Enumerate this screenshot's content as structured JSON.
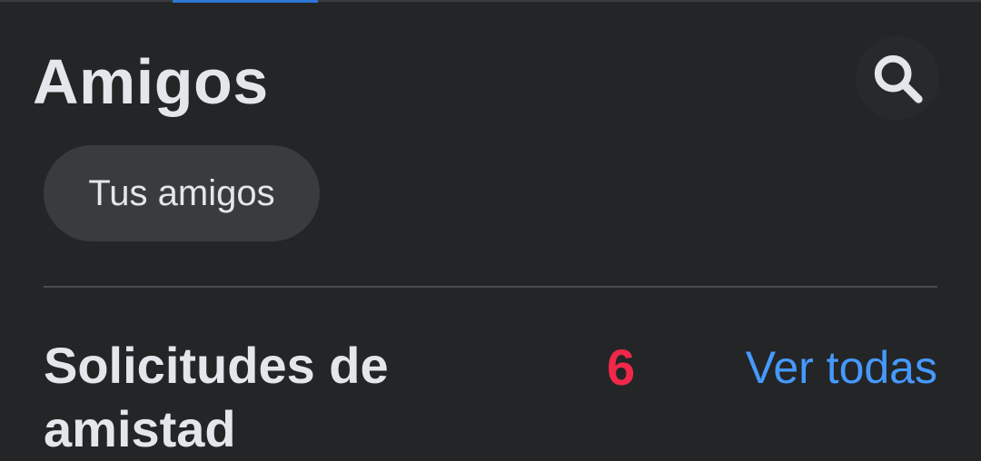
{
  "header": {
    "title": "Amigos",
    "search_icon": "search-icon"
  },
  "filters": {
    "chip_label": "Tus amigos"
  },
  "requests": {
    "title": "Solicitudes de amistad",
    "count": "6",
    "see_all_label": "Ver todas"
  },
  "colors": {
    "background": "#242526",
    "text": "#e4e6eb",
    "chip_bg": "#3a3b3c",
    "badge_red": "#f02849",
    "link_blue": "#4599ff"
  }
}
